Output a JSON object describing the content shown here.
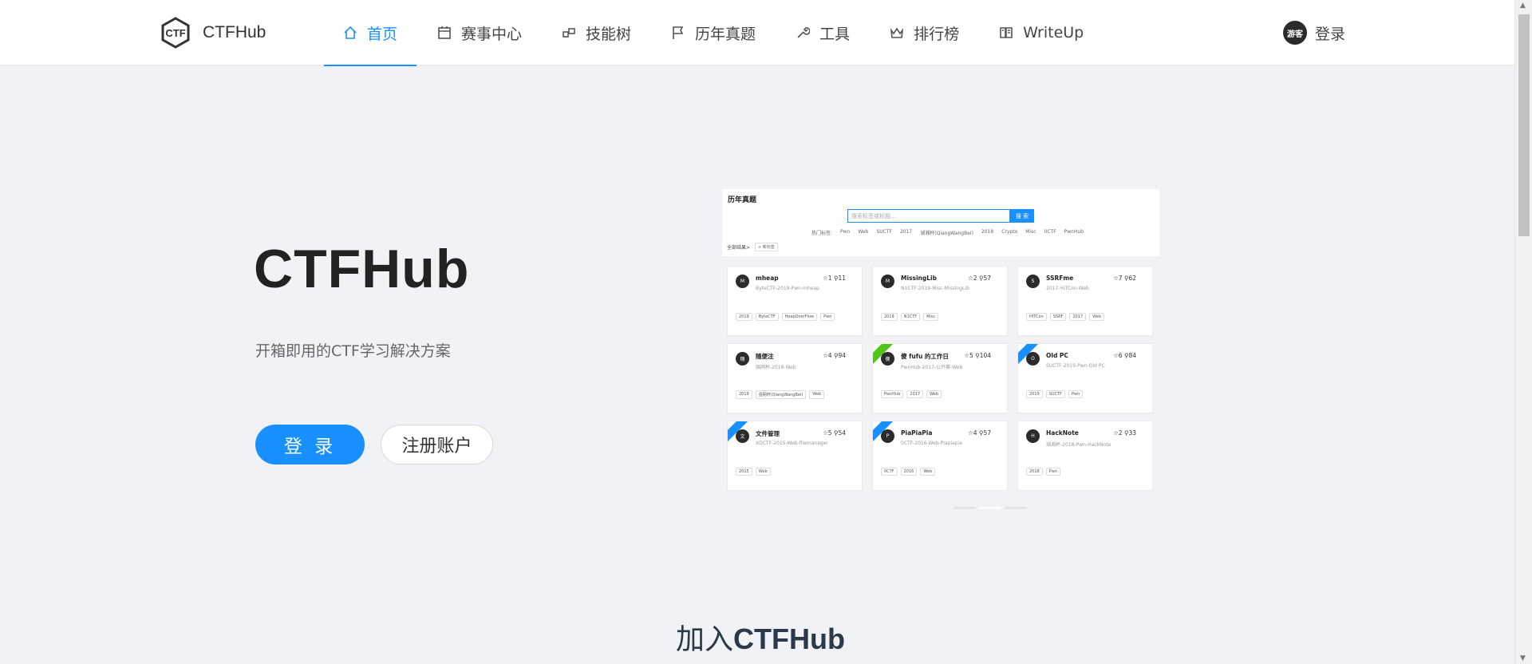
{
  "brand": {
    "name": "CTFHub"
  },
  "nav": {
    "items": [
      {
        "label": "首页",
        "icon": "home-icon",
        "active": true
      },
      {
        "label": "赛事中心",
        "icon": "calendar-icon"
      },
      {
        "label": "技能树",
        "icon": "tree-icon"
      },
      {
        "label": "历年真题",
        "icon": "flag-icon"
      },
      {
        "label": "工具",
        "icon": "wrench-icon"
      },
      {
        "label": "排行榜",
        "icon": "crown-icon"
      },
      {
        "label": "WriteUp",
        "icon": "book-icon"
      }
    ]
  },
  "user": {
    "avatar_text": "游客",
    "login_label": "登录"
  },
  "hero": {
    "title": "CTFHub",
    "subtitle": "开箱即用的CTF学习解决方案",
    "login_button": "登 录",
    "register_button": "注册账户"
  },
  "preview": {
    "title": "历年真题",
    "search_placeholder": "搜索标签或标题...",
    "search_button": "搜 索",
    "hot_label": "热门标签:",
    "hot_tags": [
      "Pwn",
      "Web",
      "SUCTF",
      "2017",
      "湖湘杯(QiangWangBei)",
      "2018",
      "Crypto",
      "Misc",
      "0CTF",
      "PwnHub"
    ],
    "all_label": "全部结果>",
    "add_tag": "+ 新标签",
    "cards": [
      {
        "avatar": "M",
        "name": "mheap",
        "stars": "☆1",
        "solves": "⚲11",
        "desc": "ByteCTF-2019-Pwn-mheap",
        "tags": [
          "2019",
          "ByteCTF",
          "HeapOverFlow",
          "Pwn"
        ],
        "ribbon": ""
      },
      {
        "avatar": "M",
        "name": "MissingLib",
        "stars": "☆2",
        "solves": "⚲57",
        "desc": "N1CTF-2019-Misc-MissingLib",
        "tags": [
          "2019",
          "N1CTF",
          "Misc"
        ],
        "ribbon": ""
      },
      {
        "avatar": "S",
        "name": "SSRFme",
        "stars": "☆7",
        "solves": "⚲62",
        "desc": "2017-HITCon-Web",
        "tags": [
          "HITCon",
          "SSRF",
          "2017",
          "Web"
        ],
        "ribbon": ""
      },
      {
        "avatar": "随",
        "name": "随便注",
        "stars": "☆4",
        "solves": "⚲94",
        "desc": "强网杯-2019-Web",
        "tags": [
          "2019",
          "强网杯(QiangWangBei)",
          "Web"
        ],
        "ribbon": ""
      },
      {
        "avatar": "傻",
        "name": "傻 fufu 的工作日",
        "stars": "☆5",
        "solves": "⚲104",
        "desc": "PwnHub-2017-公开赛-Web",
        "tags": [
          "PwnHub",
          "2017",
          "Web"
        ],
        "ribbon": "green"
      },
      {
        "avatar": "O",
        "name": "Old PC",
        "stars": "☆6",
        "solves": "⚲84",
        "desc": "SUCTF-2019-Pwn-Old PC",
        "tags": [
          "2019",
          "SUCTF",
          "Pwn"
        ],
        "ribbon": "blue"
      },
      {
        "avatar": "文",
        "name": "文件管理",
        "stars": "☆5",
        "solves": "⚲54",
        "desc": "XDCTF-2015-Web-filemanager",
        "tags": [
          "2015",
          "Web"
        ],
        "ribbon": "blue"
      },
      {
        "avatar": "P",
        "name": "PiaPiaPia",
        "stars": "☆4",
        "solves": "⚲57",
        "desc": "0CTF-2016-Web-Piapiapia",
        "tags": [
          "0CTF",
          "2016",
          "Web"
        ],
        "ribbon": "blue"
      },
      {
        "avatar": "H",
        "name": "HackNote",
        "stars": "☆2",
        "solves": "⚲33",
        "desc": "湖湘杯-2018-Pwn-HackNote",
        "tags": [
          "2018",
          "Pwn"
        ],
        "ribbon": ""
      }
    ]
  },
  "join": {
    "prefix": "加入",
    "brand": "CTFHub"
  },
  "colors": {
    "primary": "#1890ff",
    "bg": "#f0f2f5",
    "dark": "#2b2b2b"
  }
}
